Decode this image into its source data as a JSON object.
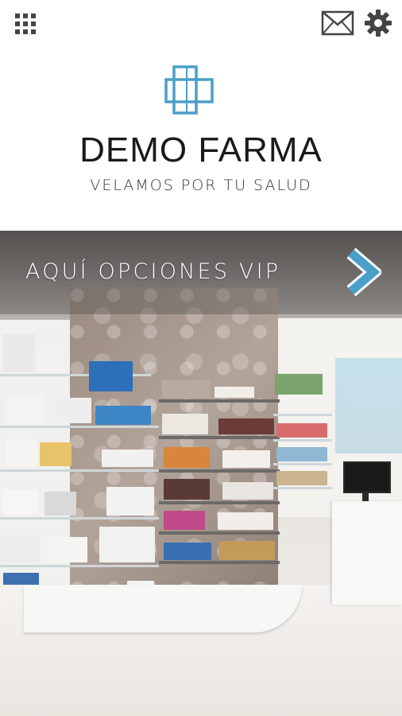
{
  "brand": {
    "name": "DEMO FARMA",
    "tagline": "VELAMOS POR TU SALUD",
    "accent_color": "#4a9fc8"
  },
  "topbar": {
    "menu_icon": "grid-menu-icon",
    "mail_icon": "envelope-icon",
    "settings_icon": "gear-icon"
  },
  "banner": {
    "label": "AQUÍ OPCIONES VIP",
    "arrow_icon": "chevron-right-icon",
    "arrow_color": "#4a9fc8"
  },
  "hero": {
    "image": "pharmacy-interior-photo"
  }
}
